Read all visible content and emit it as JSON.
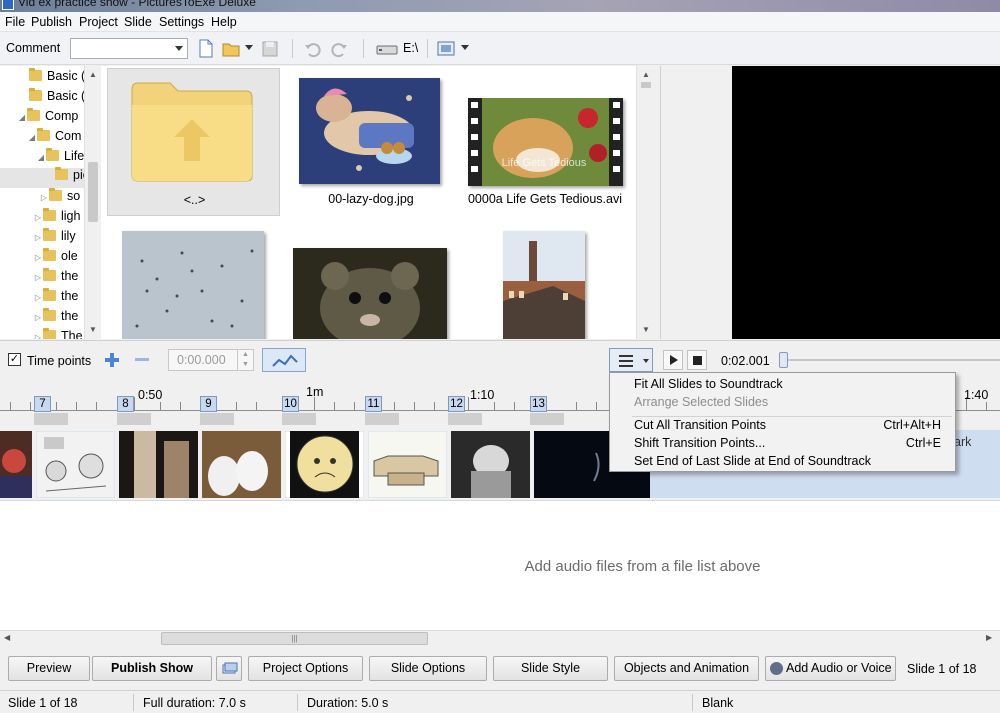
{
  "window": {
    "title": "Vid ex practice show - PicturesToExe Deluxe"
  },
  "menu": [
    "File",
    "Publish",
    "Project",
    "Slide",
    "Settings",
    "Help"
  ],
  "toolbar": {
    "comment_label": "Comment",
    "comment_value": "",
    "drive_label": "E:\\"
  },
  "tree": {
    "items": [
      {
        "label": "Basic (",
        "indent": 2,
        "expander": ""
      },
      {
        "label": "Basic (",
        "indent": 2,
        "expander": ""
      },
      {
        "label": "Comp",
        "indent": 1,
        "expander": "◢"
      },
      {
        "label": "Com",
        "indent": 2,
        "expander": "◢"
      },
      {
        "label": "Life",
        "indent": 3,
        "expander": "◢"
      },
      {
        "label": "pic",
        "indent": 4,
        "expander": ""
      },
      {
        "label": "so",
        "indent": 4,
        "expander": "▷"
      },
      {
        "label": "ligh",
        "indent": 3,
        "expander": "▷"
      },
      {
        "label": "lily",
        "indent": 3,
        "expander": "▷"
      },
      {
        "label": "ole",
        "indent": 3,
        "expander": "▷"
      },
      {
        "label": "the",
        "indent": 3,
        "expander": "▷"
      },
      {
        "label": "the",
        "indent": 3,
        "expander": "▷"
      },
      {
        "label": "the",
        "indent": 3,
        "expander": "▷"
      },
      {
        "label": "The",
        "indent": 3,
        "expander": "▷"
      }
    ]
  },
  "files": {
    "items": [
      {
        "name": "<..>"
      },
      {
        "name": "00-lazy-dog.jpg"
      },
      {
        "name": "0000a Life Gets Tedious.avi"
      },
      {
        "name": ""
      },
      {
        "name": ""
      },
      {
        "name": ""
      }
    ],
    "overlay_text": "Life Gets Tedious"
  },
  "controls": {
    "time_points_label": "Time points",
    "time_points_checked": true,
    "time_value": "0:00.000",
    "current_time": "0:02.001"
  },
  "ruler": {
    "labels": [
      "0:50",
      "1m",
      "1:10",
      "1:40"
    ],
    "slide_markers": [
      "7",
      "8",
      "9",
      "10",
      "11",
      "12",
      "13"
    ]
  },
  "context_menu": {
    "items": [
      {
        "label": "Fit All Slides to Soundtrack",
        "shortcut": "",
        "enabled": true
      },
      {
        "label": "Arrange Selected Slides",
        "shortcut": "",
        "enabled": false
      },
      {
        "label": "Cut All Transition Points",
        "shortcut": "Ctrl+Alt+H",
        "enabled": true
      },
      {
        "label": "Shift Transition Points...",
        "shortcut": "Ctrl+E",
        "enabled": true
      },
      {
        "label": "Set End of Last Slide at End of Soundtrack",
        "shortcut": "",
        "enabled": true
      }
    ]
  },
  "strip": {
    "partial_label": "ark"
  },
  "audio": {
    "placeholder": "Add audio files from a file list above"
  },
  "buttons": {
    "preview": "Preview",
    "publish": "Publish Show",
    "project_options": "Project Options",
    "slide_options": "Slide Options",
    "slide_style": "Slide Style",
    "objects_animation": "Objects and Animation",
    "add_audio": "Add Audio or Voice",
    "slide_counter": "Slide 1 of 18"
  },
  "status": {
    "slide": "Slide 1 of 18",
    "full_duration": "Full duration: 7.0 s",
    "duration": "Duration: 5.0 s",
    "transition": "Blank"
  },
  "colors": {
    "accent": "#7d9ac0",
    "selection": "#cfddf0",
    "folder": "#e8c25a"
  }
}
